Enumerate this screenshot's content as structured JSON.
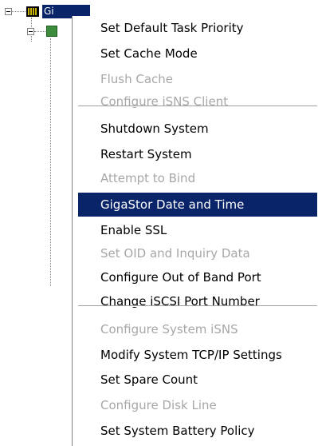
{
  "tree": {
    "root_label": "Gi"
  },
  "colors": {
    "highlight": "#0a246a",
    "disabled_text": "#a7a7a7",
    "separator": "#a0a0a0"
  },
  "context_menu": {
    "items": [
      {
        "label": "Set Default Task Priority",
        "enabled": true
      },
      {
        "label": "Set Cache Mode",
        "enabled": true
      },
      {
        "label": "Flush Cache",
        "enabled": false
      },
      {
        "label": "Configure iSNS Client",
        "enabled": false
      },
      {
        "label": "Shutdown System",
        "enabled": true
      },
      {
        "label": "Restart System",
        "enabled": true
      },
      {
        "label": "Attempt to Bind",
        "enabled": false
      },
      {
        "label": "GigaStor Date and Time",
        "enabled": true,
        "highlighted": true
      },
      {
        "label": "Enable SSL",
        "enabled": true
      },
      {
        "label": "Set OID and Inquiry Data",
        "enabled": false
      },
      {
        "label": "Configure Out of Band Port",
        "enabled": true
      },
      {
        "label": "Change iSCSI Port Number",
        "enabled": true
      },
      {
        "label": "Configure System iSNS",
        "enabled": false
      },
      {
        "label": "Modify System TCP/IP Settings",
        "enabled": true
      },
      {
        "label": "Set Spare Count",
        "enabled": true
      },
      {
        "label": "Configure Disk Line",
        "enabled": false
      },
      {
        "label": "Set System Battery Policy",
        "enabled": true
      }
    ]
  }
}
